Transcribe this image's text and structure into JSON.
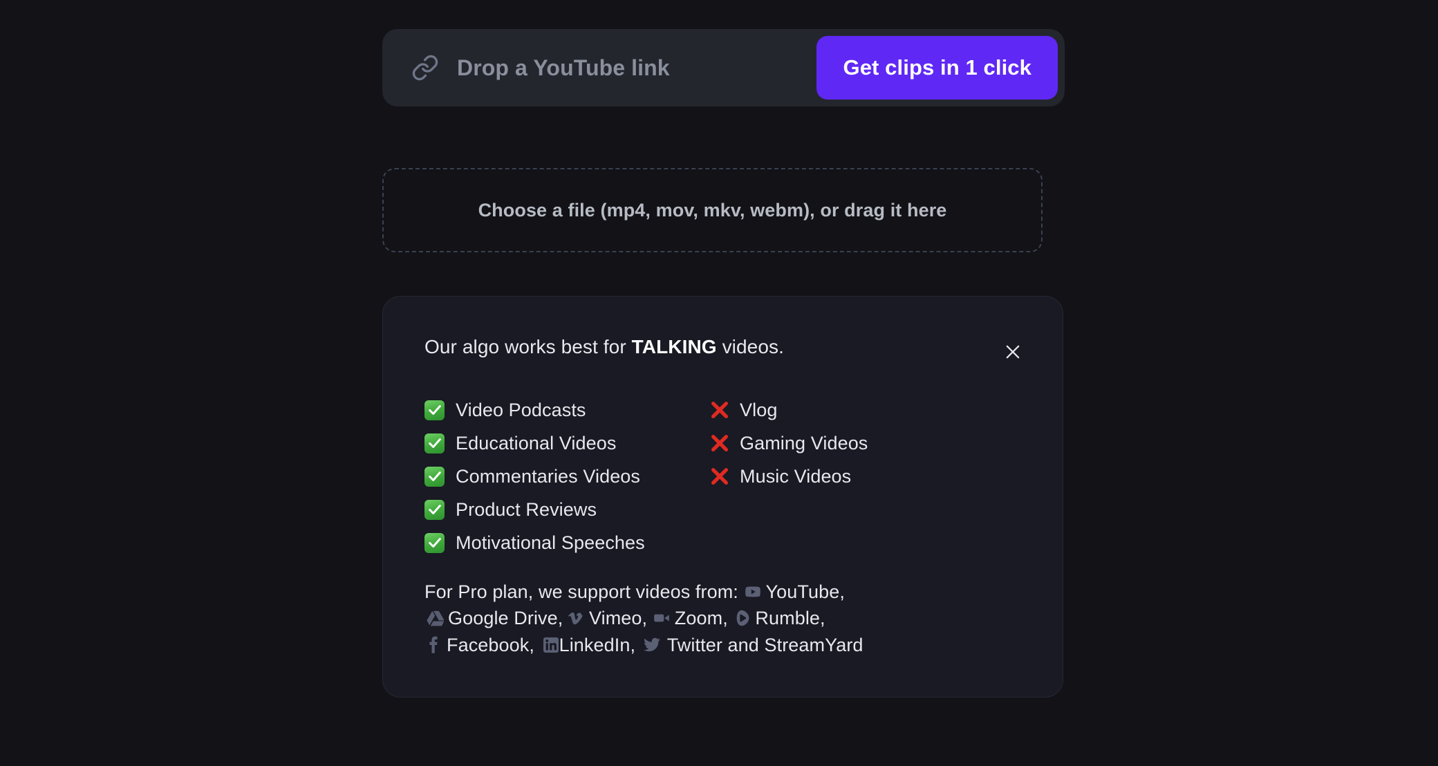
{
  "url_input": {
    "icon": "link-icon",
    "placeholder": "Drop a YouTube link",
    "value": "",
    "cta_label": "Get clips in 1 click",
    "cta_color": "#6028F5"
  },
  "dropzone": {
    "label": "Choose a file (mp4, mov, mkv, webm), or drag it here"
  },
  "info_card": {
    "title_prefix": "Our algo works best for ",
    "title_emphasis": "TALKING",
    "title_suffix": " videos.",
    "close_icon": "close-icon",
    "supported": [
      {
        "mark": "check-icon",
        "label": "Video Podcasts"
      },
      {
        "mark": "check-icon",
        "label": "Educational Videos"
      },
      {
        "mark": "check-icon",
        "label": "Commentaries Videos"
      },
      {
        "mark": "check-icon",
        "label": "Product Reviews"
      },
      {
        "mark": "check-icon",
        "label": "Motivational Speeches"
      }
    ],
    "unsupported": [
      {
        "mark": "cross-icon",
        "label": "Vlog"
      },
      {
        "mark": "cross-icon",
        "label": "Gaming Videos"
      },
      {
        "mark": "cross-icon",
        "label": "Music Videos"
      }
    ],
    "pro_note": {
      "lead": "For Pro plan, we support videos from:",
      "platforms": [
        {
          "icon": "youtube-icon",
          "name": "YouTube",
          "sep": ","
        },
        {
          "icon": "google-drive-icon",
          "name": "Google Drive",
          "sep": ","
        },
        {
          "icon": "vimeo-icon",
          "name": "Vimeo",
          "sep": ","
        },
        {
          "icon": "zoom-icon",
          "name": "Zoom",
          "sep": ","
        },
        {
          "icon": "rumble-icon",
          "name": "Rumble",
          "sep": ","
        },
        {
          "icon": "facebook-icon",
          "name": "Facebook",
          "sep": ","
        },
        {
          "icon": "linkedin-icon",
          "name": "LinkedIn",
          "sep": ","
        },
        {
          "icon": "twitter-icon",
          "name": "Twitter",
          "sep": ""
        }
      ],
      "tail": "and StreamYard"
    }
  },
  "colors": {
    "page_background": "#121217",
    "input_background": "#24262E",
    "card_background": "#191A23",
    "accent": "#6028F5",
    "check_green": "#3FA83A",
    "cross_red": "#E02A22",
    "platform_icon": "#5B6075"
  }
}
